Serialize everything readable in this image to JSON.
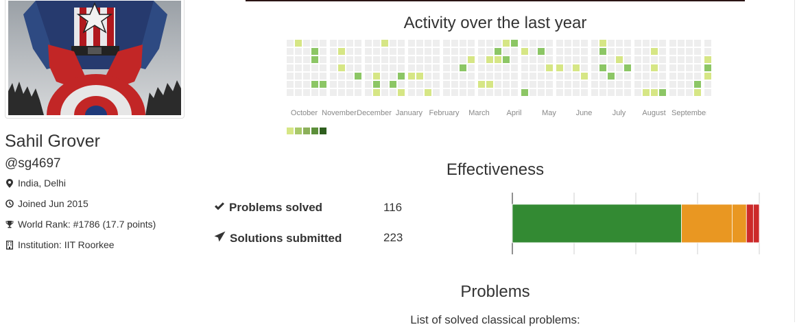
{
  "profile": {
    "name": "Sahil Grover",
    "handle": "@sg4697",
    "location": "India, Delhi",
    "joined": "Joined Jun 2015",
    "world_rank": "World Rank: #1786 (17.7 points)",
    "institution": "Institution: IIT Roorkee",
    "icons": [
      "map-marker-icon",
      "clock-icon",
      "trophy-icon",
      "building-icon"
    ]
  },
  "activity": {
    "title": "Activity over the last year",
    "months": [
      "October",
      "November",
      "December",
      "January",
      "February",
      "March",
      "April",
      "May",
      "June",
      "July",
      "August",
      "September"
    ],
    "colors": [
      "#eeeeee",
      "#d6e685",
      "#8cc665",
      "#44a340",
      "#1e6823"
    ],
    "legend_colors": [
      "#d6e685",
      "#a9c96a",
      "#8cb05a",
      "#5c8f3a",
      "#2e5e1e"
    ]
  },
  "effectiveness": {
    "title": "Effectiveness",
    "problems_solved_label": "Problems solved",
    "problems_solved_value": "116",
    "solutions_submitted_label": "Solutions submitted",
    "solutions_submitted_value": "223",
    "bar_segments": [
      {
        "color": "#338a33",
        "fraction": 0.685
      },
      {
        "color": "#e99722",
        "fraction": 0.205
      },
      {
        "color": "#e99722",
        "fraction": 0.058
      },
      {
        "color": "#cc2a2a",
        "fraction": 0.028
      },
      {
        "color": "#cc2a2a",
        "fraction": 0.024
      }
    ]
  },
  "problems": {
    "title": "Problems",
    "subtitle": "List of solved classical problems:"
  }
}
